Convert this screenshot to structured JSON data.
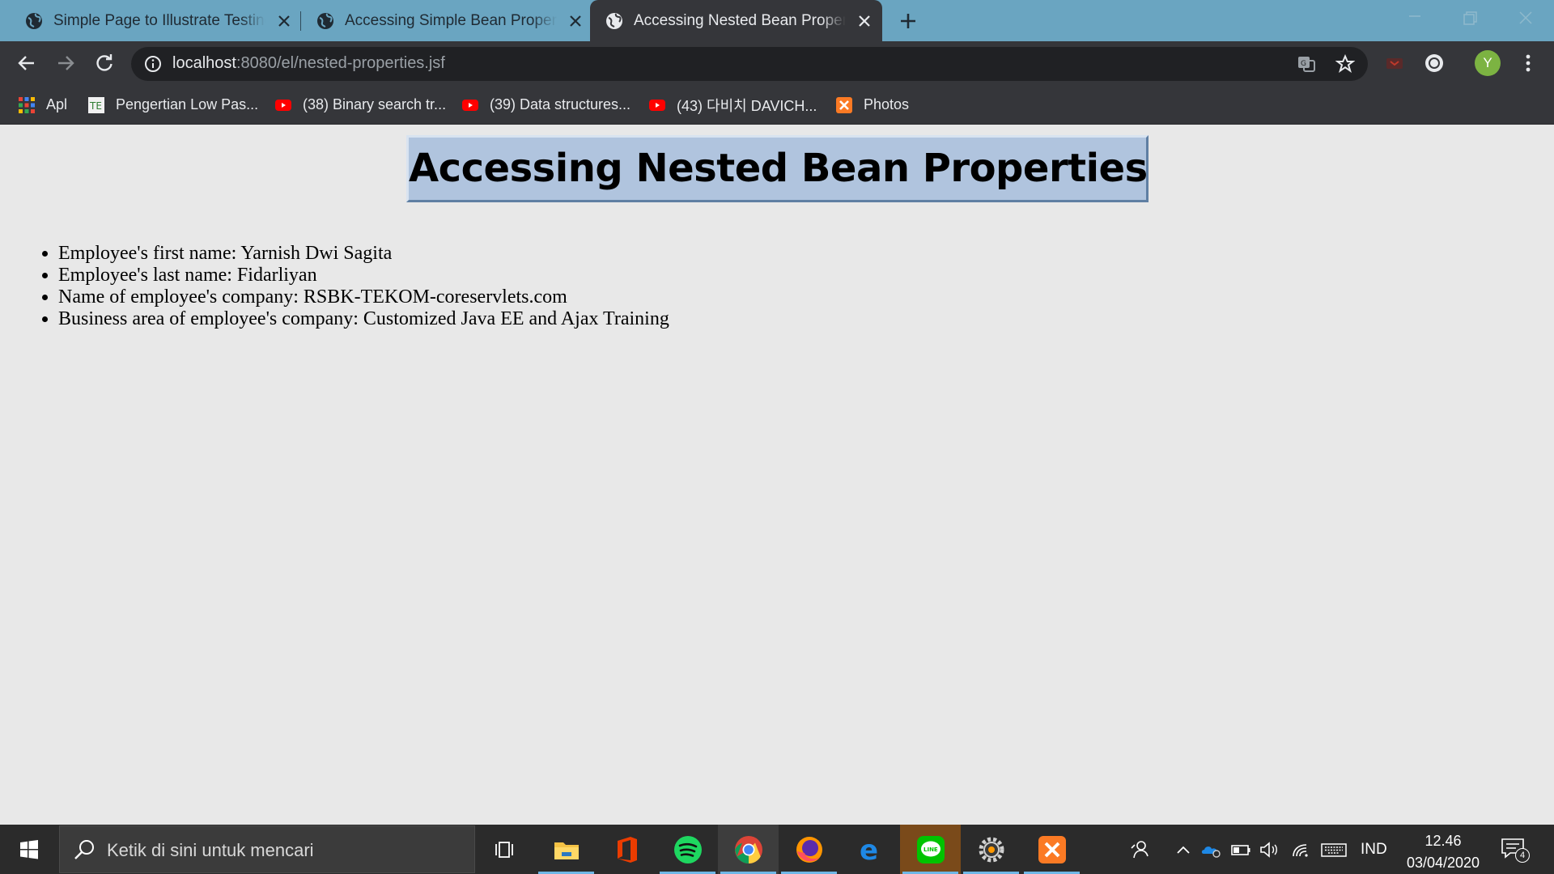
{
  "browser": {
    "tabs": [
      {
        "title": "Simple Page to Illustrate Testing Page",
        "active": false
      },
      {
        "title": "Accessing Simple Bean Properties",
        "active": false
      },
      {
        "title": "Accessing Nested Bean Properties",
        "active": true
      }
    ],
    "address": {
      "host": "localhost",
      "path": ":8080/el/nested-properties.jsf"
    },
    "profile_initial": "Y"
  },
  "bookmarks": [
    {
      "label": "Apl",
      "icon": "apps-grid-icon"
    },
    {
      "label": "Pengertian Low Pas...",
      "icon": "te-site-icon"
    },
    {
      "label": "(38) Binary search tr...",
      "icon": "youtube-icon"
    },
    {
      "label": "(39) Data structures...",
      "icon": "youtube-icon"
    },
    {
      "label": "(43) 다비치 DAVICH...",
      "icon": "youtube-icon"
    },
    {
      "label": "Photos",
      "icon": "xampp-icon"
    }
  ],
  "page": {
    "heading": "Accessing Nested Bean Properties",
    "items": [
      "Employee's first name: Yarnish Dwi Sagita",
      "Employee's last name: Fidarliyan",
      "Name of employee's company: RSBK-TEKOM-coreservlets.com",
      "Business area of employee's company: Customized Java EE and Ajax Training"
    ]
  },
  "taskbar": {
    "search_placeholder": "Ketik di sini untuk mencari",
    "apps": [
      "task-view",
      "file-explorer",
      "office",
      "spotify",
      "chrome",
      "firefox",
      "edge",
      "line",
      "settings",
      "xampp"
    ],
    "language": "IND",
    "time": "12.46",
    "date": "03/04/2020",
    "notification_count": "4"
  },
  "colors": {
    "tabstrip": "#6aa5c1",
    "toolbar": "#35363a",
    "heading_box": "#b0c4de",
    "page_bg": "#e8e8e8",
    "taskbar": "#2b2b2b"
  }
}
